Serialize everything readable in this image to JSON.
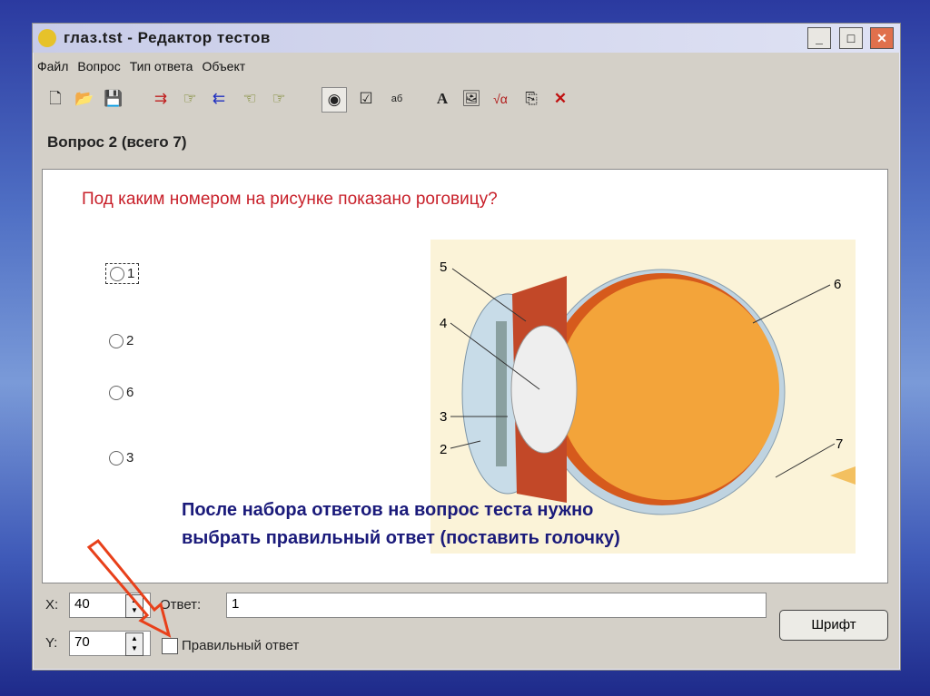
{
  "window": {
    "title": "глаз.tst - Редактор тестов",
    "controls": [
      "_",
      "□",
      "✕"
    ]
  },
  "menu": [
    "Файл",
    "Вопрос",
    "Тип ответа",
    "Объект"
  ],
  "toolbar": [
    {
      "icon": "new-file-icon",
      "glyph": "🗋"
    },
    {
      "icon": "open-folder-icon",
      "glyph": "📂"
    },
    {
      "icon": "save-icon",
      "glyph": "💾"
    },
    {
      "icon": "add-answer-icon",
      "glyph": "⇉"
    },
    {
      "icon": "insert-answer-icon",
      "glyph": "☞"
    },
    {
      "icon": "remove-answer-icon",
      "glyph": "⇇"
    },
    {
      "icon": "previous-question-icon",
      "glyph": "☜"
    },
    {
      "icon": "next-question-icon",
      "glyph": "☞"
    },
    {
      "icon": "single-choice-icon",
      "glyph": "◉"
    },
    {
      "icon": "multiple-choice-icon",
      "glyph": "☑"
    },
    {
      "icon": "text-answer-icon",
      "glyph": "аб"
    },
    {
      "icon": "font-icon",
      "glyph": "A"
    },
    {
      "icon": "image-icon",
      "glyph": "🖼"
    },
    {
      "icon": "formula-icon",
      "glyph": "√α"
    },
    {
      "icon": "object-icon",
      "glyph": "⎘"
    },
    {
      "icon": "delete-icon",
      "glyph": "✕"
    }
  ],
  "question": {
    "header": "Вопрос 2 (всего 7)",
    "text": "Под каким номером на рисунке показано роговицу?",
    "options": [
      "1",
      "2",
      "6",
      "3"
    ],
    "image_labels": [
      "5",
      "4",
      "3",
      "2",
      "6",
      "7"
    ]
  },
  "overlay_text": [
    "После набора ответов на вопрос теста нужно",
    "выбрать правильный ответ (поставить голочку)"
  ],
  "bottom": {
    "x_label": "X:",
    "x_value": "40",
    "y_label": "Y:",
    "y_value": "70",
    "answer_label": "Ответ:",
    "answer_value": "1",
    "correct_label": "Правильный ответ",
    "correct_checked": false,
    "font_button": "Шрифт"
  }
}
